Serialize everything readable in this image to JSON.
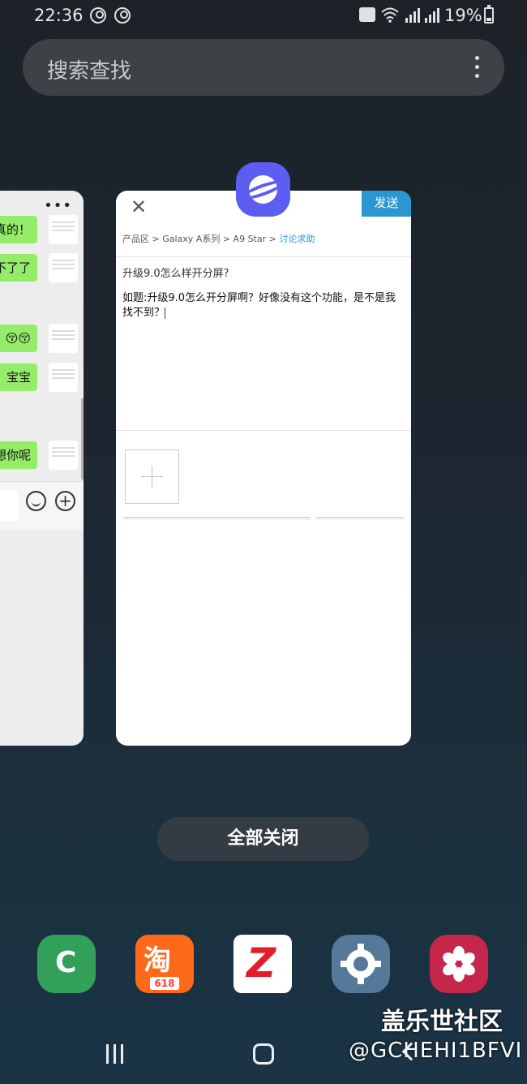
{
  "status_bar": {
    "time": "22:36",
    "battery": "19%"
  },
  "search": {
    "placeholder": "搜索查找"
  },
  "chat_card": {
    "messages": [
      "真的！",
      "不了了",
      "😚😚",
      "宝宝",
      "想你呢"
    ]
  },
  "forum_card": {
    "send_label": "发送",
    "breadcrumb": [
      "产品区",
      "Galaxy A系列",
      "A9 Star",
      "讨论求助"
    ],
    "title": "升级9.0怎么样开分屏?",
    "body": "如题:升级9.0怎么开分屏啊？好像没有这个功能，是不是我找不到？"
  },
  "actions": {
    "close_all": "全部关闭"
  },
  "dock": {
    "apps": [
      {
        "icon": "phone-icon"
      },
      {
        "icon": "taobao-icon",
        "badge": "618"
      },
      {
        "icon": "zhuanzhuan-icon"
      },
      {
        "icon": "settings-icon"
      },
      {
        "icon": "gallery-icon"
      }
    ]
  },
  "watermark": {
    "line1": "盖乐世社区",
    "line2": "@GCHEHI1BFVI"
  },
  "colors": {
    "accent": "#2b97d2",
    "chat_bubble": "#95ec69",
    "internet_app": "#5b5ef0"
  }
}
